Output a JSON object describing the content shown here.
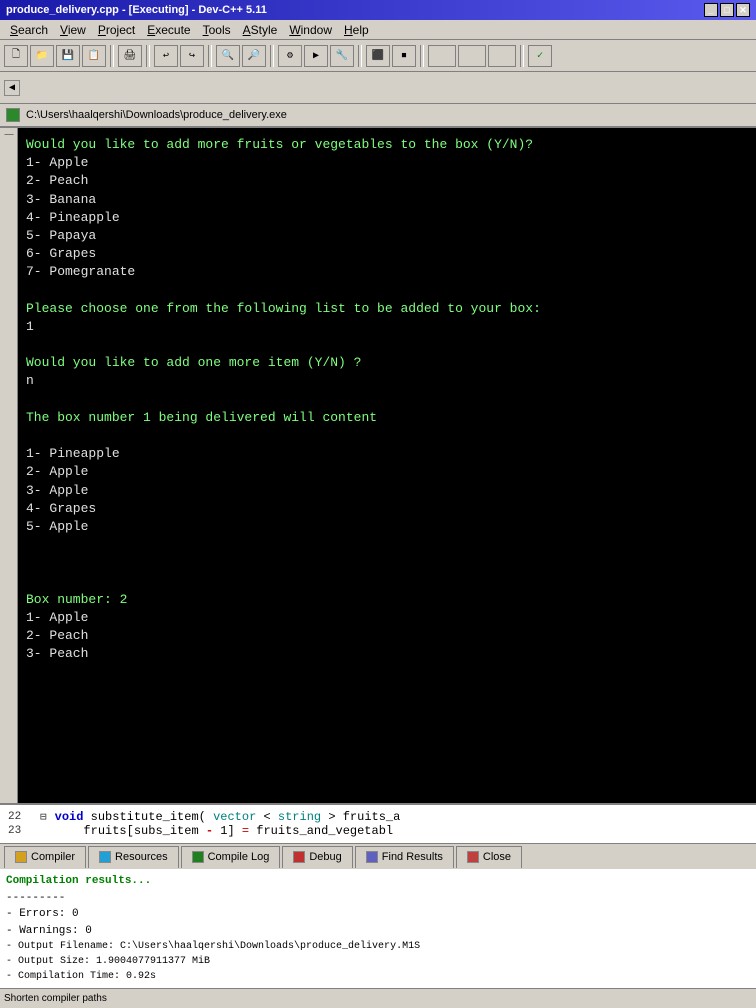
{
  "window": {
    "title": "produce_delivery.cpp - [Executing] - Dev-C++ 5.11",
    "inner_title": "C:\\Users\\haalqershi\\Downloads\\produce_delivery.exe"
  },
  "menubar": {
    "items": [
      {
        "label": "Search",
        "underline": "S"
      },
      {
        "label": "View",
        "underline": "V"
      },
      {
        "label": "Project",
        "underline": "P"
      },
      {
        "label": "Execute",
        "underline": "E"
      },
      {
        "label": "Tools",
        "underline": "T"
      },
      {
        "label": "AStyle",
        "underline": "A"
      },
      {
        "label": "Window",
        "underline": "W"
      },
      {
        "label": "Help",
        "underline": "H"
      }
    ]
  },
  "console": {
    "lines": [
      "Would you like to add more fruits or vegetables to the box (Y/N)?",
      "1- Apple",
      "2- Peach",
      "3- Banana",
      "4- Pineapple",
      "5- Papaya",
      "6- Grapes",
      "7- Pomegranate",
      "",
      "Please choose one from the following list to be added to your box:",
      "1",
      "",
      "Would you like to add one more item (Y/N) ?",
      "n",
      "",
      "The box number 1 being delivered will content",
      "",
      "1- Pineapple",
      "2- Apple",
      "3- Apple",
      "4- Grapes",
      "5- Apple",
      "",
      "",
      "",
      "Box number: 2",
      "1- Apple",
      "2- Peach",
      "3- Peach"
    ]
  },
  "code_panel": {
    "lines": [
      {
        "num": "22",
        "code": "void substitute_item(vector <string> fruits_a"
      },
      {
        "num": "23",
        "code": "    fruits[subs_item-1] = fruits_and_vegetabl"
      }
    ]
  },
  "tabs": {
    "items": [
      {
        "label": "Compiler",
        "active": false
      },
      {
        "label": "Resources",
        "active": false
      },
      {
        "label": "Compile Log",
        "active": false
      },
      {
        "label": "Debug",
        "active": false
      },
      {
        "label": "Find Results",
        "active": false
      },
      {
        "label": "Close",
        "active": false
      }
    ]
  },
  "compiler_output": {
    "title": "Compilation results...",
    "lines": [
      "---------",
      "- Errors: 0",
      "- Warnings: 0",
      "- Output Filename: C:\\Users\\haalqershi\\Downloads\\produce_delivery.M1S",
      "- Output Size: 1.9004077911377 MiB",
      "- Compilation Time: 0.92s"
    ]
  },
  "status_bar": {
    "left_text": "Shorten compiler paths"
  }
}
